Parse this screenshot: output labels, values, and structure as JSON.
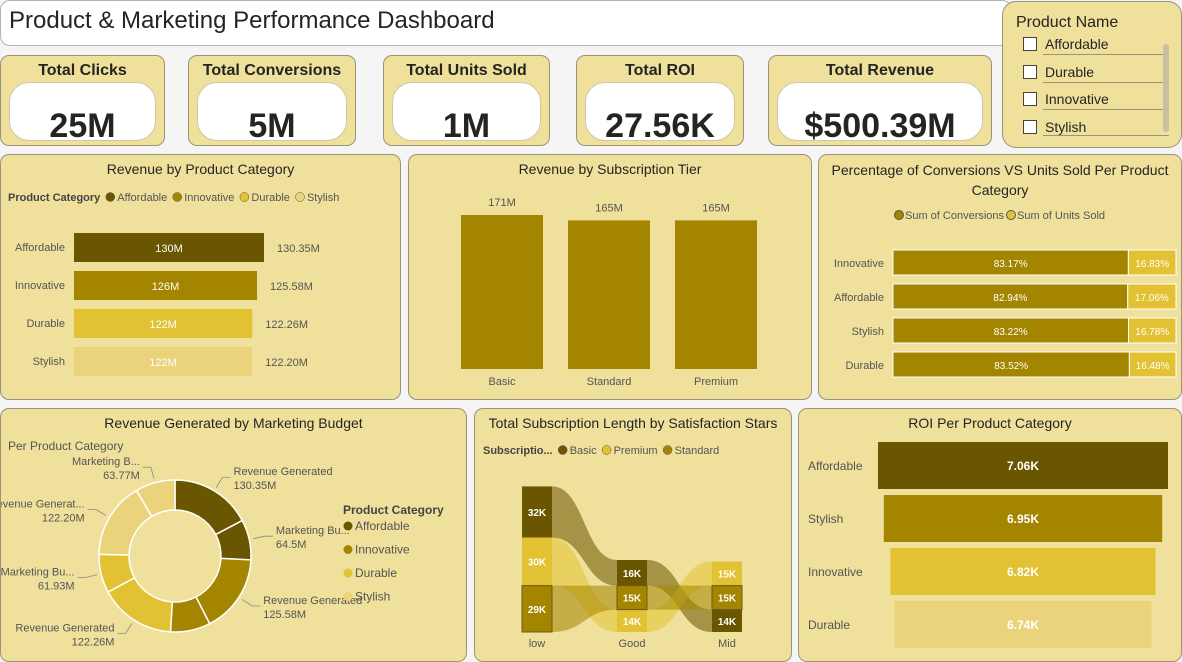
{
  "title": "Product & Marketing Performance Dashboard",
  "kpis": [
    {
      "label": "Total Clicks",
      "value": "25M"
    },
    {
      "label": "Total Conversions",
      "value": "5M"
    },
    {
      "label": "Total Units Sold",
      "value": "1M"
    },
    {
      "label": "Total ROI",
      "value": "27.56K"
    },
    {
      "label": "Total Revenue",
      "value": "$500.39M"
    }
  ],
  "slicer": {
    "title": "Product Name",
    "items": [
      "Affordable",
      "Durable",
      "Innovative",
      "Stylish"
    ]
  },
  "colors": {
    "affordable": "#6a5500",
    "innovative": "#a38500",
    "durable": "#e2c232",
    "stylish": "#ead37a",
    "panel": "#efe09c"
  },
  "chart_data": [
    {
      "id": "rev_by_category",
      "type": "bar",
      "orientation": "horizontal",
      "title": "Revenue by Product Category",
      "legend_title": "Product Category",
      "legend": [
        "Affordable",
        "Innovative",
        "Durable",
        "Stylish"
      ],
      "categories": [
        "Affordable",
        "Innovative",
        "Durable",
        "Stylish"
      ],
      "values": [
        130.35,
        125.58,
        122.26,
        122.2
      ],
      "inner_labels": [
        "130M",
        "126M",
        "122M",
        "122M"
      ],
      "outer_labels": [
        "130.35M",
        "125.58M",
        "122.26M",
        "122.20M"
      ]
    },
    {
      "id": "rev_by_tier",
      "type": "bar",
      "title": "Revenue by Subscription Tier",
      "categories": [
        "Basic",
        "Standard",
        "Premium"
      ],
      "values": [
        171,
        165,
        165
      ],
      "labels": [
        "171M",
        "165M",
        "165M"
      ]
    },
    {
      "id": "pct_conv_units",
      "type": "bar",
      "orientation": "horizontal",
      "stacked": "100%",
      "title": "Percentage of Conversions VS Units Sold Per Product Category",
      "legend": [
        "Sum of Conversions",
        "Sum of Units Sold"
      ],
      "categories": [
        "Innovative",
        "Affordable",
        "Stylish",
        "Durable"
      ],
      "series": [
        {
          "name": "Sum of Conversions",
          "values": [
            83.17,
            82.94,
            83.22,
            83.52
          ],
          "labels": [
            "83.17%",
            "82.94%",
            "83.22%",
            "83.52%"
          ]
        },
        {
          "name": "Sum of Units Sold",
          "values": [
            16.83,
            17.06,
            16.78,
            16.48
          ],
          "labels": [
            "16.83%",
            "17.06%",
            "16.78%",
            "16.48%"
          ]
        }
      ]
    },
    {
      "id": "rev_marketing_budget",
      "type": "pie",
      "donut": true,
      "title": "Revenue Generated by Marketing Budget",
      "subtitle": "Per Product Category",
      "legend_title": "Product Category",
      "legend": [
        "Affordable",
        "Innovative",
        "Durable",
        "Stylish"
      ],
      "slices": [
        {
          "category": "Affordable",
          "label": "Revenue Generated",
          "value": 130.35,
          "value_label": "130.35M"
        },
        {
          "category": "Affordable",
          "label": "Marketing Bu...",
          "value": 64.5,
          "value_label": "64.5M"
        },
        {
          "category": "Innovative",
          "label": "Revenue Generated",
          "value": 125.58,
          "value_label": "125.58M"
        },
        {
          "category": "Innovative",
          "label": "Marketing Bu...",
          "value": 64.0,
          "value_label": ""
        },
        {
          "category": "Durable",
          "label": "Revenue Generated",
          "value": 122.26,
          "value_label": "122.26M"
        },
        {
          "category": "Durable",
          "label": "Marketing Bu...",
          "value": 61.93,
          "value_label": "61.93M"
        },
        {
          "category": "Stylish",
          "label": "Revenue Generat...",
          "value": 122.2,
          "value_label": "122.20M"
        },
        {
          "category": "Stylish",
          "label": "Marketing B...",
          "value": 63.77,
          "value_label": "63.77M"
        }
      ]
    },
    {
      "id": "sub_length_stars",
      "type": "bar",
      "stacked": true,
      "title": "Total Subscription Length by Satisfaction Stars",
      "legend_title": "Subscriptio...",
      "legend": [
        "Basic",
        "Premium",
        "Standard"
      ],
      "categories": [
        "low",
        "Good",
        "Mid"
      ],
      "series": [
        {
          "name": "Basic",
          "values": [
            32,
            16,
            14
          ],
          "labels": [
            "32K",
            "16K",
            "14K"
          ]
        },
        {
          "name": "Premium",
          "values": [
            30,
            14,
            15
          ],
          "labels": [
            "30K",
            "14K",
            "15K"
          ]
        },
        {
          "name": "Standard",
          "values": [
            29,
            15,
            15
          ],
          "labels": [
            "29K",
            "15K",
            "15K"
          ]
        }
      ]
    },
    {
      "id": "roi_by_category",
      "type": "bar",
      "orientation": "horizontal",
      "title": "ROI Per Product Category",
      "categories": [
        "Affordable",
        "Stylish",
        "Innovative",
        "Durable"
      ],
      "values": [
        7.06,
        6.95,
        6.82,
        6.74
      ],
      "labels": [
        "7.06K",
        "6.95K",
        "6.82K",
        "6.74K"
      ]
    }
  ]
}
